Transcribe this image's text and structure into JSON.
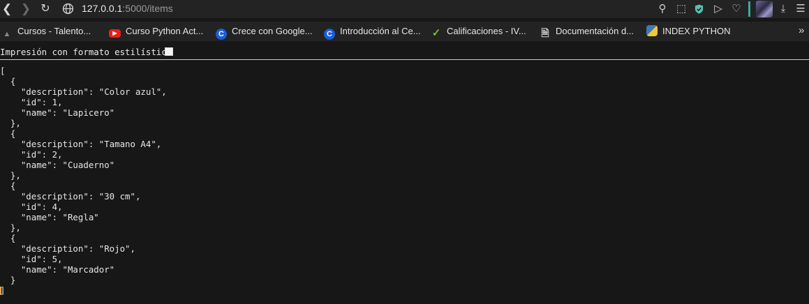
{
  "browser": {
    "url_host": "127.0.0.1",
    "url_rest": ":5000/items",
    "icons": {
      "back": "chevron-left-icon",
      "forward": "chevron-right-icon",
      "reload": "reload-icon",
      "site_info": "globe-icon"
    },
    "toolbar_icons": [
      "pin-icon",
      "screenshot-icon",
      "shield-icon",
      "play-icon",
      "heart-icon",
      "avatar",
      "download-icon",
      "menu-icon"
    ]
  },
  "bookmarks": [
    {
      "label": "Cursos - Talento...",
      "icon": "talento-icon"
    },
    {
      "label": "Curso Python Act...",
      "icon": "youtube-icon"
    },
    {
      "label": "Crece con Google...",
      "icon": "c-logo-icon"
    },
    {
      "label": "Introducción al Ce...",
      "icon": "c-logo-icon"
    },
    {
      "label": "Calificaciones - IV...",
      "icon": "checkmark-icon"
    },
    {
      "label": "Documentación d...",
      "icon": "document-icon"
    },
    {
      "label": "INDEX PYTHON",
      "icon": "python-icon"
    }
  ],
  "bookmarks_more": "»",
  "viewer": {
    "pretty_print_label": "Impresión con formato estilístico",
    "pretty_print_checked": false
  },
  "items": [
    {
      "description": "Color azul",
      "id": 1,
      "name": "Lapicero"
    },
    {
      "description": "Tamano A4",
      "id": 2,
      "name": "Cuaderno"
    },
    {
      "description": "30 cm",
      "id": 4,
      "name": "Regla"
    },
    {
      "description": "Rojo",
      "id": 5,
      "name": "Marcador"
    }
  ],
  "json_text": "[\n  {\n    \"description\": \"Color azul\",\n    \"id\": 1,\n    \"name\": \"Lapicero\"\n  },\n  {\n    \"description\": \"Tamano A4\",\n    \"id\": 2,\n    \"name\": \"Cuaderno\"\n  },\n  {\n    \"description\": \"30 cm\",\n    \"id\": 4,\n    \"name\": \"Regla\"\n  },\n  {\n    \"description\": \"Rojo\",\n    \"id\": 5,\n    \"name\": \"Marcador\"\n  }\n]",
  "colors": {
    "page_background": "#171717",
    "toolbar_background": "#232323",
    "accent": "#3fa79a",
    "youtube_red": "#e62117",
    "google_blue": "#1a5ed8"
  }
}
